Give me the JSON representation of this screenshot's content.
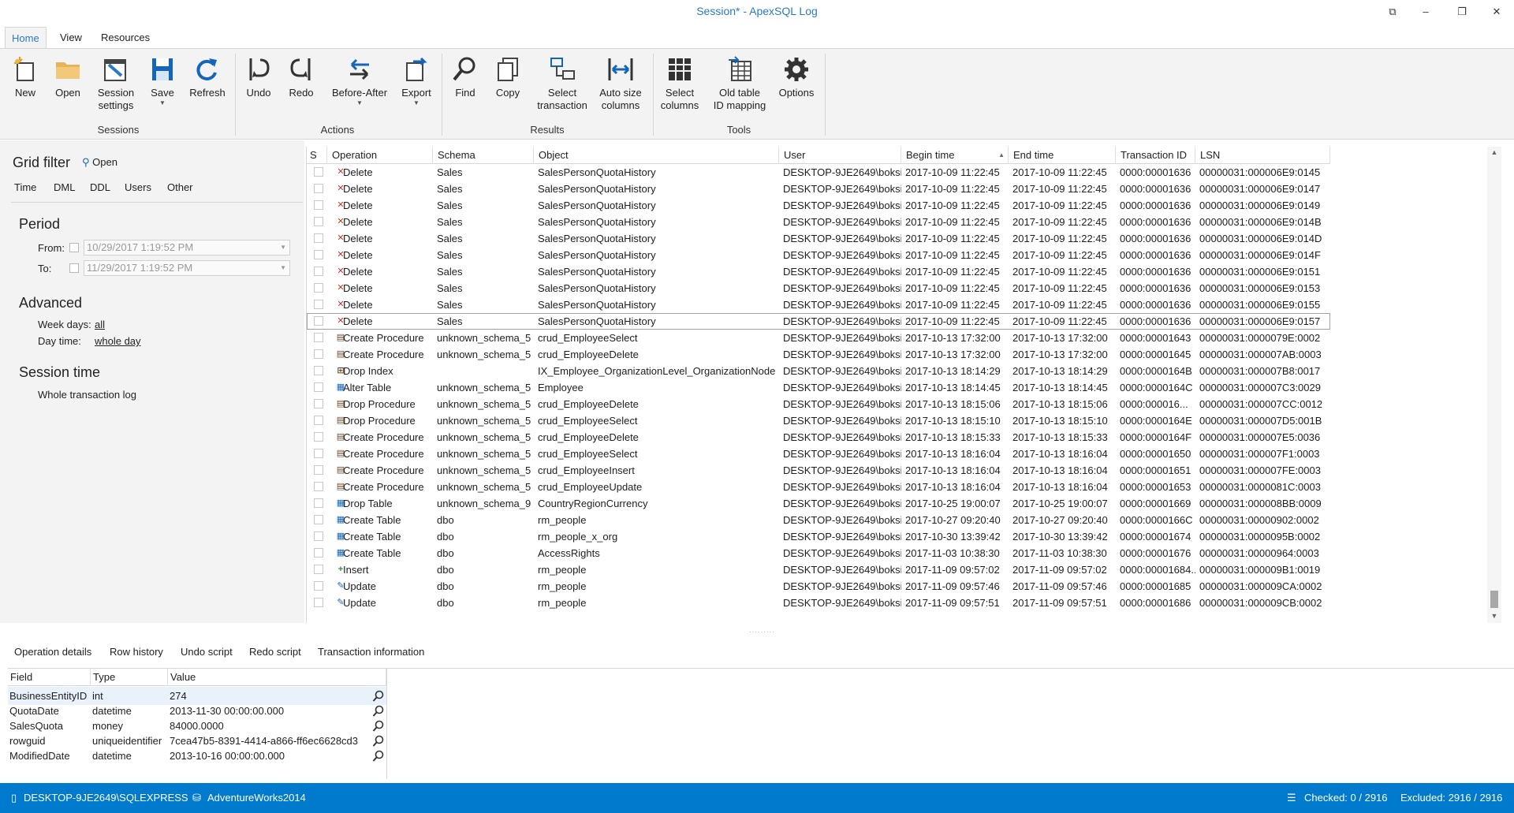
{
  "window": {
    "title": "Session* - ApexSQL Log",
    "buttons": {
      "restore_down": "⧉",
      "minimize": "–",
      "maximize": "❐",
      "close": "✕"
    }
  },
  "ribbon": {
    "tabs": [
      "Home",
      "View",
      "Resources"
    ],
    "active_tab": "Home",
    "buttons": {
      "new": "New",
      "open": "Open",
      "session_settings_1": "Session",
      "session_settings_2": "settings",
      "save": "Save",
      "refresh": "Refresh",
      "undo": "Undo",
      "redo": "Redo",
      "before_after": "Before-After",
      "export": "Export",
      "find": "Find",
      "copy": "Copy",
      "select_transaction_1": "Select",
      "select_transaction_2": "transaction",
      "auto_size_1": "Auto size",
      "auto_size_2": "columns",
      "select_columns_1": "Select",
      "select_columns_2": "columns",
      "old_table_1": "Old table",
      "old_table_2": "ID mapping",
      "options": "Options"
    },
    "groups": {
      "sessions": "Sessions",
      "actions": "Actions",
      "results": "Results",
      "tools": "Tools"
    }
  },
  "filter": {
    "title": "Grid filter",
    "open_label": "Open",
    "tabs": [
      "Time",
      "DML",
      "DDL",
      "Users",
      "Other"
    ],
    "period_title": "Period",
    "from_label": "From:",
    "from_value": "10/29/2017 1:19:52 PM",
    "to_label": "To:",
    "to_value": "11/29/2017 1:19:52 PM",
    "advanced_title": "Advanced",
    "week_days_label": "Week days:",
    "week_days_value": "all",
    "day_time_label": "Day time:",
    "day_time_value": "whole day",
    "session_time_title": "Session time",
    "session_time_value": "Whole transaction log"
  },
  "grid": {
    "columns": [
      "S",
      "Operation",
      "Schema",
      "Object",
      "User",
      "Begin time",
      "End time",
      "Transaction ID",
      "LSN"
    ],
    "sort_indicator": "▲",
    "rows": [
      {
        "op": "Delete",
        "icon": "delete",
        "schema": "Sales",
        "object": "SalesPersonQuotaHistory",
        "user": "DESKTOP-9JE2649\\boksi",
        "begin": "2017-10-09 11:22:45",
        "end": "2017-10-09 11:22:45",
        "tid": "0000:00001636",
        "lsn": "00000031:000006E9:0145"
      },
      {
        "op": "Delete",
        "icon": "delete",
        "schema": "Sales",
        "object": "SalesPersonQuotaHistory",
        "user": "DESKTOP-9JE2649\\boksi",
        "begin": "2017-10-09 11:22:45",
        "end": "2017-10-09 11:22:45",
        "tid": "0000:00001636",
        "lsn": "00000031:000006E9:0147"
      },
      {
        "op": "Delete",
        "icon": "delete",
        "schema": "Sales",
        "object": "SalesPersonQuotaHistory",
        "user": "DESKTOP-9JE2649\\boksi",
        "begin": "2017-10-09 11:22:45",
        "end": "2017-10-09 11:22:45",
        "tid": "0000:00001636",
        "lsn": "00000031:000006E9:0149"
      },
      {
        "op": "Delete",
        "icon": "delete",
        "schema": "Sales",
        "object": "SalesPersonQuotaHistory",
        "user": "DESKTOP-9JE2649\\boksi",
        "begin": "2017-10-09 11:22:45",
        "end": "2017-10-09 11:22:45",
        "tid": "0000:00001636",
        "lsn": "00000031:000006E9:014B"
      },
      {
        "op": "Delete",
        "icon": "delete",
        "schema": "Sales",
        "object": "SalesPersonQuotaHistory",
        "user": "DESKTOP-9JE2649\\boksi",
        "begin": "2017-10-09 11:22:45",
        "end": "2017-10-09 11:22:45",
        "tid": "0000:00001636",
        "lsn": "00000031:000006E9:014D"
      },
      {
        "op": "Delete",
        "icon": "delete",
        "schema": "Sales",
        "object": "SalesPersonQuotaHistory",
        "user": "DESKTOP-9JE2649\\boksi",
        "begin": "2017-10-09 11:22:45",
        "end": "2017-10-09 11:22:45",
        "tid": "0000:00001636",
        "lsn": "00000031:000006E9:014F"
      },
      {
        "op": "Delete",
        "icon": "delete",
        "schema": "Sales",
        "object": "SalesPersonQuotaHistory",
        "user": "DESKTOP-9JE2649\\boksi",
        "begin": "2017-10-09 11:22:45",
        "end": "2017-10-09 11:22:45",
        "tid": "0000:00001636",
        "lsn": "00000031:000006E9:0151"
      },
      {
        "op": "Delete",
        "icon": "delete",
        "schema": "Sales",
        "object": "SalesPersonQuotaHistory",
        "user": "DESKTOP-9JE2649\\boksi",
        "begin": "2017-10-09 11:22:45",
        "end": "2017-10-09 11:22:45",
        "tid": "0000:00001636",
        "lsn": "00000031:000006E9:0153"
      },
      {
        "op": "Delete",
        "icon": "delete",
        "schema": "Sales",
        "object": "SalesPersonQuotaHistory",
        "user": "DESKTOP-9JE2649\\boksi",
        "begin": "2017-10-09 11:22:45",
        "end": "2017-10-09 11:22:45",
        "tid": "0000:00001636",
        "lsn": "00000031:000006E9:0155"
      },
      {
        "op": "Delete",
        "icon": "delete",
        "schema": "Sales",
        "object": "SalesPersonQuotaHistory",
        "user": "DESKTOP-9JE2649\\boksi",
        "begin": "2017-10-09 11:22:45",
        "end": "2017-10-09 11:22:45",
        "tid": "0000:00001636",
        "lsn": "00000031:000006E9:0157",
        "selected": true
      },
      {
        "op": "Create Procedure",
        "icon": "proc",
        "schema": "unknown_schema_5",
        "object": "crud_EmployeeSelect",
        "user": "DESKTOP-9JE2649\\boksi",
        "begin": "2017-10-13 17:32:00",
        "end": "2017-10-13 17:32:00",
        "tid": "0000:00001643",
        "lsn": "00000031:0000079E:0002"
      },
      {
        "op": "Create Procedure",
        "icon": "proc",
        "schema": "unknown_schema_5",
        "object": "crud_EmployeeDelete",
        "user": "DESKTOP-9JE2649\\boksi",
        "begin": "2017-10-13 17:32:00",
        "end": "2017-10-13 17:32:00",
        "tid": "0000:00001645",
        "lsn": "00000031:000007AB:0003"
      },
      {
        "op": "Drop Index",
        "icon": "index",
        "schema": "",
        "object": "IX_Employee_OrganizationLevel_OrganizationNode",
        "user": "DESKTOP-9JE2649\\boksi",
        "begin": "2017-10-13 18:14:29",
        "end": "2017-10-13 18:14:29",
        "tid": "0000:0000164B",
        "lsn": "00000031:000007B8:0017"
      },
      {
        "op": "Alter Table",
        "icon": "table",
        "schema": "unknown_schema_5",
        "object": "Employee",
        "user": "DESKTOP-9JE2649\\boksi",
        "begin": "2017-10-13 18:14:45",
        "end": "2017-10-13 18:14:45",
        "tid": "0000:0000164C",
        "lsn": "00000031:000007C3:0029"
      },
      {
        "op": "Drop Procedure",
        "icon": "proc",
        "schema": "unknown_schema_5",
        "object": "crud_EmployeeDelete",
        "user": "DESKTOP-9JE2649\\boksi",
        "begin": "2017-10-13 18:15:06",
        "end": "2017-10-13 18:15:06",
        "tid": "0000:000016...",
        "lsn": "00000031:000007CC:0012"
      },
      {
        "op": "Drop Procedure",
        "icon": "proc",
        "schema": "unknown_schema_5",
        "object": "crud_EmployeeSelect",
        "user": "DESKTOP-9JE2649\\boksi",
        "begin": "2017-10-13 18:15:10",
        "end": "2017-10-13 18:15:10",
        "tid": "0000:0000164E",
        "lsn": "00000031:000007D5:001B"
      },
      {
        "op": "Create Procedure",
        "icon": "proc",
        "schema": "unknown_schema_5",
        "object": "crud_EmployeeDelete",
        "user": "DESKTOP-9JE2649\\boksi",
        "begin": "2017-10-13 18:15:33",
        "end": "2017-10-13 18:15:33",
        "tid": "0000:0000164F",
        "lsn": "00000031:000007E5:0036"
      },
      {
        "op": "Create Procedure",
        "icon": "proc",
        "schema": "unknown_schema_5",
        "object": "crud_EmployeeSelect",
        "user": "DESKTOP-9JE2649\\boksi",
        "begin": "2017-10-13 18:16:04",
        "end": "2017-10-13 18:16:04",
        "tid": "0000:00001650",
        "lsn": "00000031:000007F1:0003"
      },
      {
        "op": "Create Procedure",
        "icon": "proc",
        "schema": "unknown_schema_5",
        "object": "crud_EmployeeInsert",
        "user": "DESKTOP-9JE2649\\boksi",
        "begin": "2017-10-13 18:16:04",
        "end": "2017-10-13 18:16:04",
        "tid": "0000:00001651",
        "lsn": "00000031:000007FE:0003"
      },
      {
        "op": "Create Procedure",
        "icon": "proc",
        "schema": "unknown_schema_5",
        "object": "crud_EmployeeUpdate",
        "user": "DESKTOP-9JE2649\\boksi",
        "begin": "2017-10-13 18:16:04",
        "end": "2017-10-13 18:16:04",
        "tid": "0000:00001653",
        "lsn": "00000031:0000081C:0003"
      },
      {
        "op": "Drop Table",
        "icon": "table",
        "schema": "unknown_schema_9",
        "object": "CountryRegionCurrency",
        "user": "DESKTOP-9JE2649\\boksi",
        "begin": "2017-10-25 19:00:07",
        "end": "2017-10-25 19:00:07",
        "tid": "0000:00001669",
        "lsn": "00000031:000008BB:0009"
      },
      {
        "op": "Create Table",
        "icon": "table",
        "schema": "dbo",
        "object": "rm_people",
        "user": "DESKTOP-9JE2649\\boksi",
        "begin": "2017-10-27 09:20:40",
        "end": "2017-10-27 09:20:40",
        "tid": "0000:0000166C",
        "lsn": "00000031:00000902:0002"
      },
      {
        "op": "Create Table",
        "icon": "table",
        "schema": "dbo",
        "object": "rm_people_x_org",
        "user": "DESKTOP-9JE2649\\boksi",
        "begin": "2017-10-30 13:39:42",
        "end": "2017-10-30 13:39:42",
        "tid": "0000:00001674",
        "lsn": "00000031:0000095B:0002"
      },
      {
        "op": "Create Table",
        "icon": "table",
        "schema": "dbo",
        "object": "AccessRights",
        "user": "DESKTOP-9JE2649\\boksi",
        "begin": "2017-11-03 10:38:30",
        "end": "2017-11-03 10:38:30",
        "tid": "0000:00001676",
        "lsn": "00000031:00000964:0003"
      },
      {
        "op": "Insert",
        "icon": "insert",
        "schema": "dbo",
        "object": "rm_people",
        "user": "DESKTOP-9JE2649\\boksi",
        "begin": "2017-11-09 09:57:02",
        "end": "2017-11-09 09:57:02",
        "tid": "0000:00001684...",
        "lsn": "00000031:000009B1:0019"
      },
      {
        "op": "Update",
        "icon": "update",
        "schema": "dbo",
        "object": "rm_people",
        "user": "DESKTOP-9JE2649\\boksi",
        "begin": "2017-11-09 09:57:46",
        "end": "2017-11-09 09:57:46",
        "tid": "0000:00001685",
        "lsn": "00000031:000009CA:0002"
      },
      {
        "op": "Update",
        "icon": "update",
        "schema": "dbo",
        "object": "rm_people",
        "user": "DESKTOP-9JE2649\\boksi",
        "begin": "2017-11-09 09:57:51",
        "end": "2017-11-09 09:57:51",
        "tid": "0000:00001686",
        "lsn": "00000031:000009CB:0002"
      }
    ]
  },
  "bottom_tabs": [
    "Operation details",
    "Row history",
    "Undo script",
    "Redo script",
    "Transaction information"
  ],
  "details": {
    "columns": [
      "Field",
      "Type",
      "Value"
    ],
    "rows": [
      {
        "field": "BusinessEntityID",
        "type": "int",
        "value": "274",
        "selected": true
      },
      {
        "field": "QuotaDate",
        "type": "datetime",
        "value": "2013-11-30 00:00:00.000"
      },
      {
        "field": "SalesQuota",
        "type": "money",
        "value": "84000.0000"
      },
      {
        "field": "rowguid",
        "type": "uniqueidentifier",
        "value": "7cea47b5-8391-4414-a866-ff6ec6628cd3"
      },
      {
        "field": "ModifiedDate",
        "type": "datetime",
        "value": "2013-10-16 00:00:00.000"
      }
    ]
  },
  "status": {
    "server": "DESKTOP-9JE2649\\SQLEXPRESS",
    "database": "AdventureWorks2014",
    "checked": "Checked: 0 / 2916",
    "excluded": "Excluded: 2916 / 2916"
  },
  "colors": {
    "accent": "#2a7ac8",
    "status_bar": "#007acc",
    "delete_red": "#c0392b",
    "insert_green": "#2e8b3c"
  }
}
